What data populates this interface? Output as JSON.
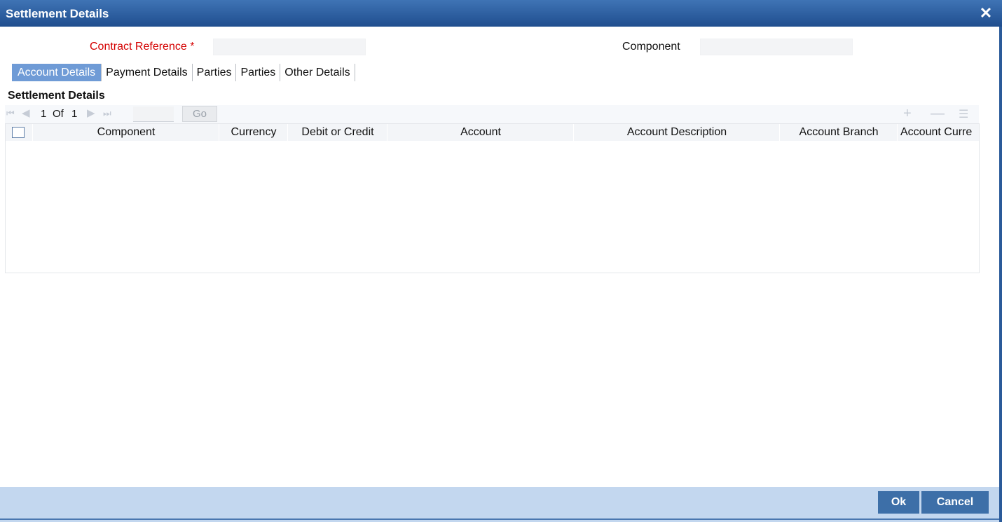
{
  "window": {
    "title": "Settlement Details",
    "close_icon": "close-icon",
    "close_glyph": "✕"
  },
  "form": {
    "contract_reference": {
      "label": "Contract Reference",
      "required_mark": "*",
      "value": ""
    },
    "component": {
      "label": "Component",
      "value": ""
    }
  },
  "tabs": [
    {
      "label": "Account Details",
      "active": true
    },
    {
      "label": "Payment Details",
      "active": false
    },
    {
      "label": "Parties",
      "active": false
    },
    {
      "label": "Parties",
      "active": false
    },
    {
      "label": "Other Details",
      "active": false
    }
  ],
  "section": {
    "title": "Settlement Details"
  },
  "pager": {
    "current": "1",
    "of_label": "Of",
    "total": "1",
    "go_label": "Go",
    "page_input": "",
    "icons": {
      "first": "first-page-icon",
      "prev": "previous-page-icon",
      "next": "next-page-icon",
      "last": "last-page-icon",
      "add": "add-row-icon",
      "remove": "remove-row-icon",
      "columns": "column-list-icon"
    }
  },
  "grid": {
    "columns": [
      "Component",
      "Currency",
      "Debit or Credit",
      "Account",
      "Account Description",
      "Account Branch",
      "Account Curre"
    ],
    "rows": []
  },
  "footer": {
    "ok_label": "Ok",
    "cancel_label": "Cancel"
  },
  "colors": {
    "title_bar": "#1f4e8e",
    "active_tab": "#6f9bd6",
    "required_label": "#d40000",
    "footer_bg": "#c3d7ef",
    "button_bg": "#3d6fa8"
  }
}
